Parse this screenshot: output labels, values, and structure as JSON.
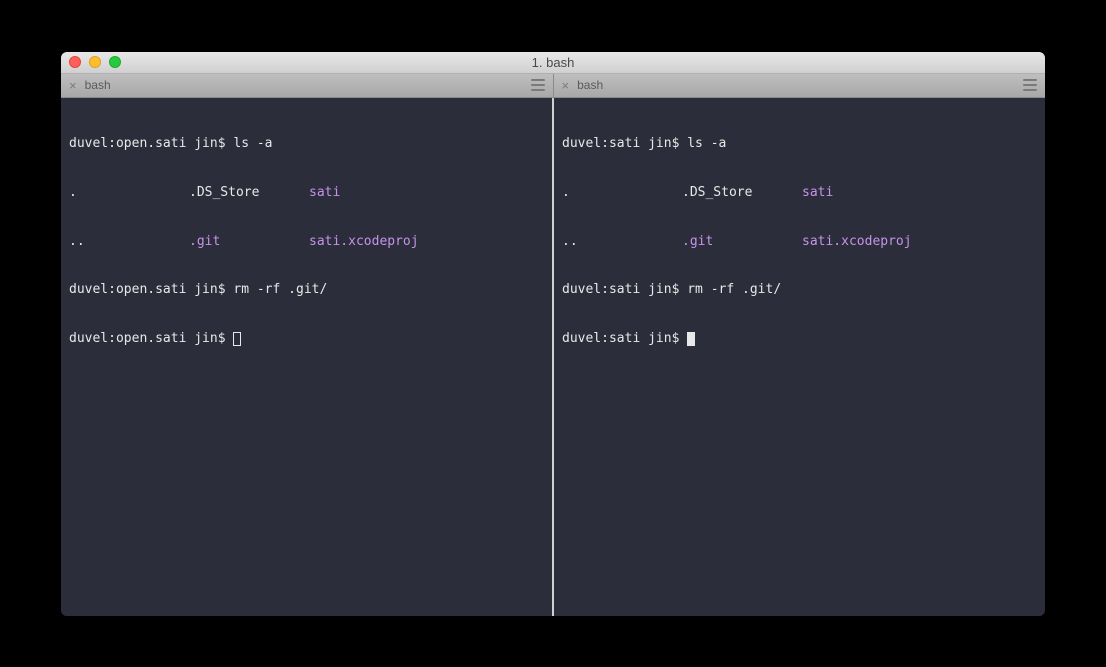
{
  "window": {
    "title": "1. bash"
  },
  "tabs": [
    {
      "label": "bash"
    },
    {
      "label": "bash"
    }
  ],
  "panes": {
    "left": {
      "prompt1": "duvel:open.sati jin$ ",
      "cmd1": "ls -a",
      "listing": {
        "r1c1": ".",
        "r1c2": ".DS_Store",
        "r1c3": "sati",
        "r2c1": "..",
        "r2c2": ".git",
        "r2c3": "sati.xcodeproj"
      },
      "prompt2": "duvel:open.sati jin$ ",
      "cmd2": "rm -rf .git/",
      "prompt3": "duvel:open.sati jin$ "
    },
    "right": {
      "prompt1": "duvel:sati jin$ ",
      "cmd1": "ls -a",
      "listing": {
        "r1c1": ".",
        "r1c2": ".DS_Store",
        "r1c3": "sati",
        "r2c1": "..",
        "r2c2": ".git",
        "r2c3": "sati.xcodeproj"
      },
      "prompt2": "duvel:sati jin$ ",
      "cmd2": "rm -rf .git/",
      "prompt3": "duvel:sati jin$ "
    }
  }
}
